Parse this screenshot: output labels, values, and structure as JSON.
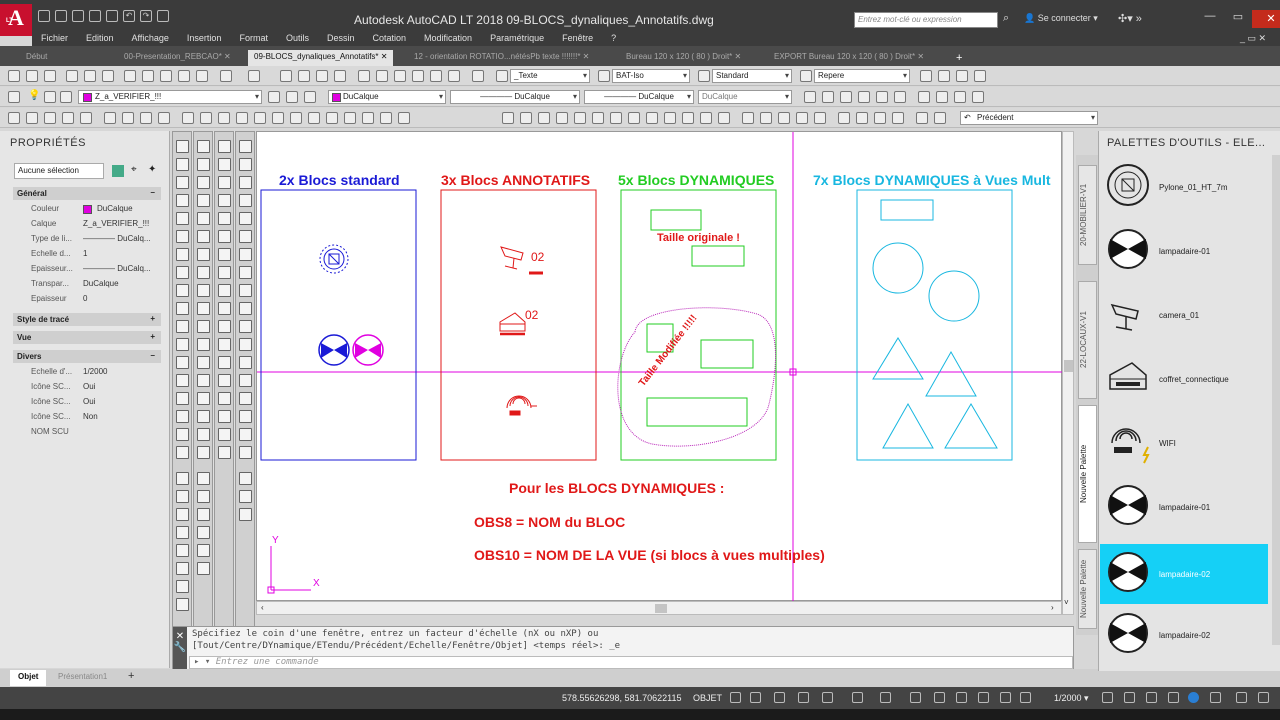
{
  "title_bar": {
    "app_logo": "A",
    "app_logo_sub": "LT",
    "title": "Autodesk AutoCAD LT 2018    09-BLOCS_dynaliques_Annotatifs.dwg",
    "search_placeholder": "Entrez mot-clé ou expression",
    "sign_in": "Se connecter"
  },
  "menu": [
    "Fichier",
    "Edition",
    "Affichage",
    "Insertion",
    "Format",
    "Outils",
    "Dessin",
    "Cotation",
    "Modification",
    "Paramétrique",
    "Fenêtre",
    "?"
  ],
  "doc_tabs": [
    {
      "label": "Début",
      "active": false
    },
    {
      "label": "00-Presentation_REBCAO*",
      "active": false
    },
    {
      "label": "09-BLOCS_dynaliques_Annotatifs*",
      "active": true
    },
    {
      "label": "12 - orientation ROTATIO...nétésPb texte !!!!!!!*",
      "active": false
    },
    {
      "label": "Bureau 120 x 120 ( 80 ) Droit*",
      "active": false
    },
    {
      "label": "EXPORT Bureau 120 x 120 ( 80 ) Droit*",
      "active": false
    }
  ],
  "toolbar": {
    "text_style": "_Texte",
    "dim_style": "BAT-Iso",
    "table_style": "Standard",
    "mleader_style": "Repere",
    "layer": "Z_a_VERIFIER_!!!",
    "color": "DuCalque",
    "linetype": "DuCalque",
    "lineweight": "DuCalque",
    "plotstyle": "DuCalque",
    "view_previous": "Précédent"
  },
  "properties": {
    "title": "PROPRIÉTÉS",
    "selection": "Aucune sélection",
    "sections": {
      "general": "Général",
      "plot_style": "Style de tracé",
      "view": "Vue",
      "misc": "Divers"
    },
    "general_rows": [
      {
        "key": "Couleur",
        "value": "DuCalque"
      },
      {
        "key": "Calque",
        "value": "Z_a_VERIFIER_!!!"
      },
      {
        "key": "Type de li...",
        "value": "———— DuCalq..."
      },
      {
        "key": "Echelle d...",
        "value": "1"
      },
      {
        "key": "Epaisseur...",
        "value": "———— DuCalq..."
      },
      {
        "key": "Transpar...",
        "value": "DuCalque"
      },
      {
        "key": "Epaisseur",
        "value": "0"
      }
    ],
    "misc_rows": [
      {
        "key": "Echelle d'...",
        "value": "1/2000"
      },
      {
        "key": "Icône SC...",
        "value": "Oui"
      },
      {
        "key": "Icône SC...",
        "value": "Oui"
      },
      {
        "key": "Icône SC...",
        "value": "Non"
      },
      {
        "key": "NOM SCU",
        "value": ""
      }
    ]
  },
  "drawing": {
    "headers": [
      {
        "text": "2x Blocs standard",
        "color": "#1a1ad6"
      },
      {
        "text": "3x Blocs ANNOTATIFS",
        "color": "#e01818"
      },
      {
        "text": "5x Blocs DYNAMIQUES",
        "color": "#22cc22"
      },
      {
        "text": "7x Blocs DYNAMIQUES à Vues Mult",
        "color": "#18b7e0"
      }
    ],
    "tag_02_a": "02",
    "tag_02_b": "02",
    "taille_originale": "Taille originale !",
    "taille_modifiee": "Taille Modifiée !!!!!",
    "notes": [
      "Pour les BLOCS DYNAMIQUES :",
      "OBS8 = NOM du BLOC",
      "OBS10 = NOM DE LA VUE (si blocs à vues multiples)"
    ],
    "ucs_y": "Y",
    "ucs_x": "X"
  },
  "command": {
    "line1": "Spécifiez le coin d'une fenêtre, entrez un facteur d'échelle (nX ou nXP) ou",
    "line2": "[Tout/Centre/DYnamique/ETendu/Précédent/Echelle/Fenêtre/Objet] <temps réel>: _e",
    "placeholder": "Entrez une commande"
  },
  "layout_tabs": [
    {
      "label": "Objet",
      "active": true
    },
    {
      "label": "Présentation1",
      "active": false
    }
  ],
  "status": {
    "coords": "578.55626298, 581.70622115",
    "mode": "OBJET",
    "scale": "1/2000"
  },
  "tool_palette": {
    "title": "PALETTES D'OUTILS - ELE...",
    "side_tabs": [
      "20-MOBILIER-V1",
      "22-LOCAUX-V1",
      "Nouvelle Palette",
      "Nouvelle Palette"
    ],
    "items": [
      {
        "label": "Pylone_01_HT_7m",
        "icon": "pylon-icon",
        "active": false
      },
      {
        "label": "lampadaire-01",
        "icon": "lamp-icon",
        "active": false
      },
      {
        "label": "camera_01",
        "icon": "camera-icon",
        "active": false
      },
      {
        "label": "coffret_connectique",
        "icon": "box-icon",
        "active": false
      },
      {
        "label": "WIFI",
        "icon": "wifi-icon",
        "active": false
      },
      {
        "label": "lampadaire-01",
        "icon": "lamp-icon",
        "active": false
      },
      {
        "label": "lampadaire-02",
        "icon": "lamp-icon",
        "active": true
      },
      {
        "label": "lampadaire-02",
        "icon": "lamp-icon",
        "active": false
      }
    ]
  },
  "colors": {
    "magenta": "#e000e0",
    "red": "#e01818",
    "green": "#22cc22",
    "cyan": "#18b7e0",
    "blue": "#1a1ad6",
    "highlight": "#15d0f6"
  }
}
